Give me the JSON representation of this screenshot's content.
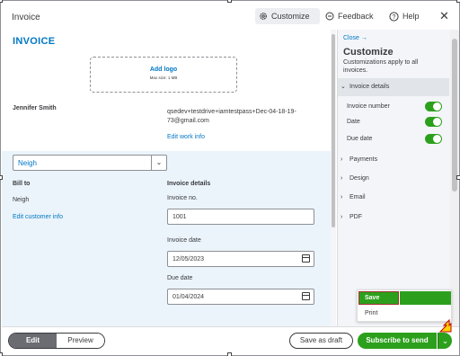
{
  "header": {
    "title": "Invoice",
    "customize_label": "Customize",
    "feedback_label": "Feedback",
    "help_label": "Help",
    "close_glyph": "✕"
  },
  "document": {
    "heading": "INVOICE",
    "logo": {
      "add_label": "Add logo",
      "max_size": "Max size: 1 MB"
    },
    "company": {
      "name": "Jennifer Smith",
      "email": "qsedev+testdrive+iamtestpass+Dec-04-18-19-73@gmail.com",
      "edit_link": "Edit work info"
    },
    "customer_select": {
      "value": "Neigh",
      "chevron": "⌄"
    },
    "bill_to": {
      "label": "Bill to",
      "name": "Neigh",
      "edit_link": "Edit customer info"
    },
    "invoice_details": {
      "label": "Invoice details",
      "fields": [
        {
          "label": "Invoice no.",
          "value": "1001"
        },
        {
          "label": "Invoice date",
          "value": "12/05/2023"
        },
        {
          "label": "Due date",
          "value": "01/04/2024"
        }
      ]
    }
  },
  "panel": {
    "close_link": "Close →",
    "title": "Customize",
    "subtitle": "Customizations apply to all invoices.",
    "open_section": {
      "label": "Invoice details",
      "toggles": [
        {
          "label": "Invoice number",
          "on": true
        },
        {
          "label": "Date",
          "on": true
        },
        {
          "label": "Due date",
          "on": true
        }
      ]
    },
    "sections": [
      "Payments",
      "Design",
      "Email",
      "PDF"
    ]
  },
  "dropdown": {
    "save": "Save",
    "print": "Print"
  },
  "footer": {
    "edit": "Edit",
    "preview": "Preview",
    "save_draft": "Save as draft",
    "subscribe_send": "Subscribe to send",
    "caret": "⌄"
  },
  "colors": {
    "accent_blue": "#0077c5",
    "brand_green": "#2ca01c",
    "highlight_blue": "#ebf4fa"
  }
}
